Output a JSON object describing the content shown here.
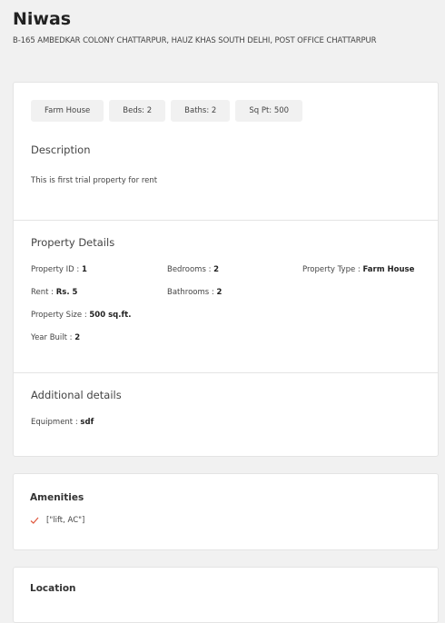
{
  "property": {
    "name": "Niwas",
    "address": "B-165 AMBEDKAR COLONY CHATTARPUR, HAUZ KHAS SOUTH DELHI, POST OFFICE CHATTARPUR"
  },
  "chips": [
    "Farm House",
    "Beds: 2",
    "Baths: 2",
    "Sq Pt: 500"
  ],
  "description": {
    "title": "Description",
    "text": "This is first trial property for rent"
  },
  "details": {
    "title": "Property Details",
    "items": {
      "property_id": {
        "label": "Property ID : ",
        "value": "1"
      },
      "bedrooms": {
        "label": "Bedrooms : ",
        "value": "2"
      },
      "property_type": {
        "label": "Property Type : ",
        "value": "Farm House"
      },
      "rent": {
        "label": "Rent : ",
        "value": "Rs. 5"
      },
      "bathrooms": {
        "label": "Bathrooms : ",
        "value": "2"
      },
      "property_size": {
        "label": "Property Size : ",
        "value": "500 sq.ft."
      },
      "year_built": {
        "label": "Year Built : ",
        "value": "2"
      }
    }
  },
  "additional": {
    "title": "Additional details",
    "equipment": {
      "label": "Equipment : ",
      "value": "sdf"
    }
  },
  "amenities": {
    "title": "Amenities",
    "items": [
      "[\"lift, AC\"]"
    ],
    "check_color": "#e0573d"
  },
  "location": {
    "title": "Location"
  }
}
